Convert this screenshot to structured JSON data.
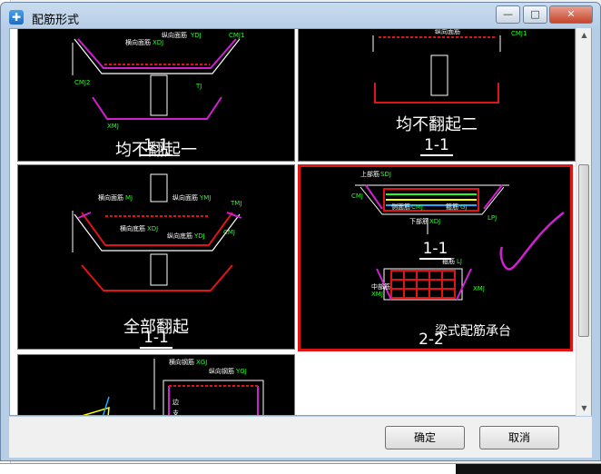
{
  "window": {
    "title": "配筋形式"
  },
  "title_buttons": {
    "minimize": "—",
    "maximize": "□",
    "close": "✕"
  },
  "tiles": [
    {
      "caption": "均不翻起一",
      "section": "1-1",
      "labels": {
        "top_bar": "横向面筋",
        "long_bar": "纵向面筋",
        "cap1": "XDJ",
        "cap2": "YDJ",
        "side": "CMJ1",
        "side2": "CMJ2",
        "slope": "TJ",
        "bottom": "XMJ"
      }
    },
    {
      "caption": "均不翻起二",
      "section": "1-1",
      "labels": {
        "long_bar": "纵向面筋",
        "side": "CMJ1"
      }
    },
    {
      "caption": "全部翻起",
      "section": "1-1",
      "labels": {
        "top_bar": "横向面筋",
        "long_bar": "纵向面筋",
        "cap1": "MJ",
        "cap2": "YMJ",
        "mid": "横向底筋",
        "mid2": "纵向底筋",
        "cap3": "XDJ",
        "cap4": "YDJ",
        "side": "CMJ",
        "slope": "TMJ"
      }
    },
    {
      "caption": "梁式配筋承台",
      "section": "1-1",
      "section2": "2-2",
      "selected": true,
      "labels": {
        "top": "上部筋",
        "top_code": "SDJ",
        "side": "侧面筋",
        "side_code": "CMJ",
        "tie": "箍筋",
        "tie_code": "GJ",
        "leg": "LPJ",
        "lower": "下部筋",
        "lower_code": "XDJ",
        "hoop": "箍筋",
        "hoop_code": "LJ",
        "mid": "中部筋",
        "bottom_code": "XMJ",
        "end_code": "XMJ",
        "cmj": "CMJ"
      }
    },
    {
      "caption": "",
      "section": "",
      "labels": {
        "top_bar": "横向钢筋",
        "top_code": "XGJ",
        "long_bar": "纵向钢筋",
        "long_code": "YGJ",
        "a": "边",
        "b": "支"
      }
    }
  ],
  "buttons": {
    "ok": "确定",
    "cancel": "取消"
  },
  "colors": {
    "selection": "#e01414",
    "rebar": "#e01414",
    "frame": "#ffffff",
    "accent": "#d020d0",
    "label_green": "#22ff22"
  }
}
